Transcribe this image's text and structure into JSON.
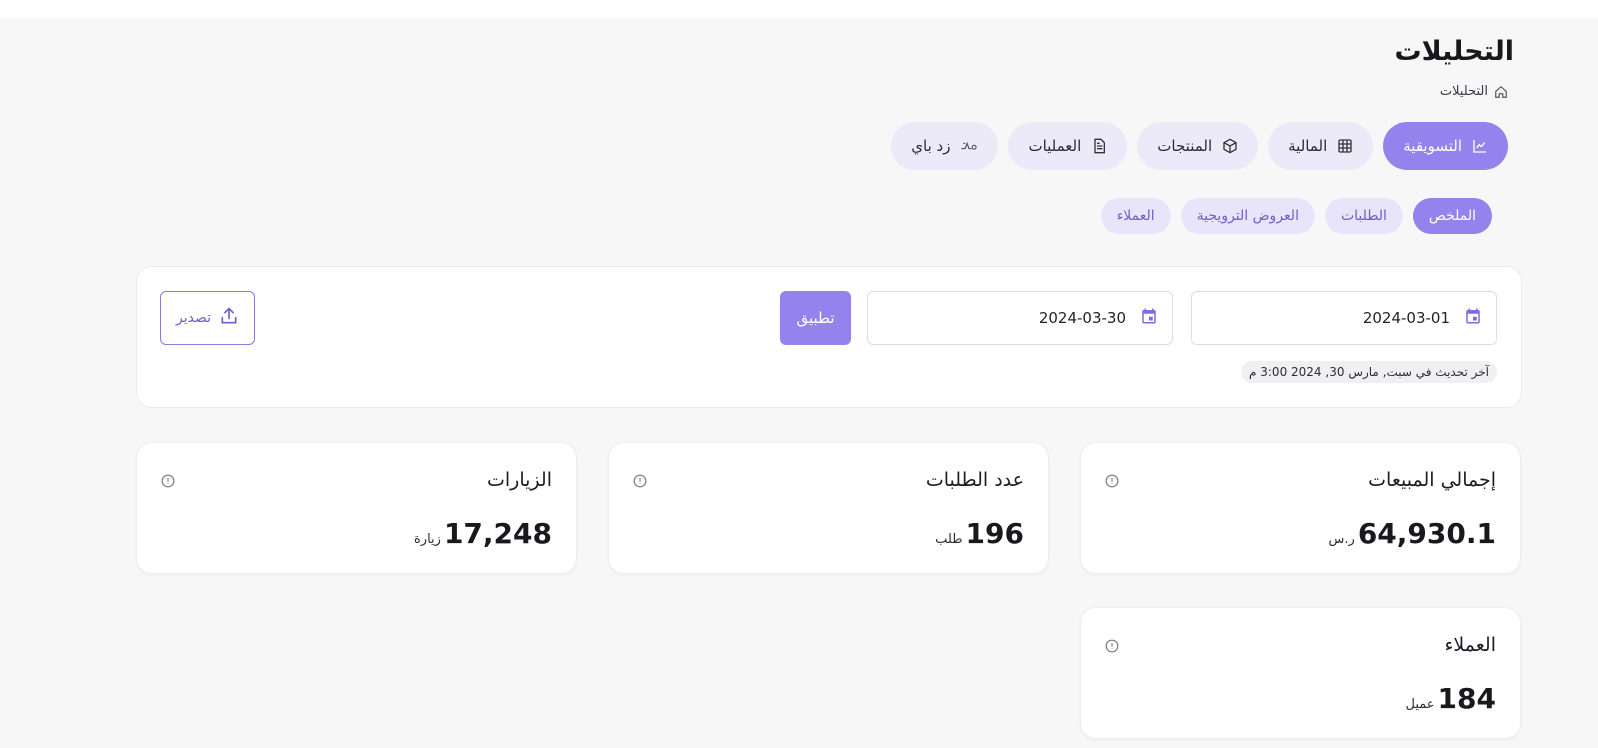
{
  "header": {
    "title": "التحليلات",
    "breadcrumb": "التحليلات"
  },
  "main_tabs": [
    {
      "label": "التسويقية",
      "icon": "chart-line-icon",
      "active": true
    },
    {
      "label": "المالية",
      "icon": "table-grid-icon",
      "active": false
    },
    {
      "label": "المنتجات",
      "icon": "box-icon",
      "active": false
    },
    {
      "label": "العمليات",
      "icon": "document-icon",
      "active": false
    },
    {
      "label": "زد باي",
      "icon": "zid-pay-icon",
      "active": false
    }
  ],
  "sub_tabs": [
    {
      "label": "الملخص",
      "active": true
    },
    {
      "label": "الطلبات",
      "active": false
    },
    {
      "label": "العروض الترويجية",
      "active": false
    },
    {
      "label": "العملاء",
      "active": false
    }
  ],
  "filters": {
    "date_from": "2024-03-01",
    "date_to": "2024-03-30",
    "apply_label": "تطبيق",
    "export_label": "تصدير",
    "last_updated": "آخر تحديث في سبت, مارس 30, 2024 3:00 م"
  },
  "stats": {
    "sales": {
      "title": "إجمالي المبيعات",
      "value": "64,930.1",
      "unit": "ر.س"
    },
    "orders": {
      "title": "عدد الطلبات",
      "value": "196",
      "unit": "طلب"
    },
    "visits": {
      "title": "الزيارات",
      "value": "17,248",
      "unit": "زيارة"
    },
    "customers": {
      "title": "العملاء",
      "value": "184",
      "unit": "عميل"
    }
  },
  "colors": {
    "accent": "#9583ed",
    "accent_light": "#e8e4fa",
    "background": "#f7f7f7"
  }
}
